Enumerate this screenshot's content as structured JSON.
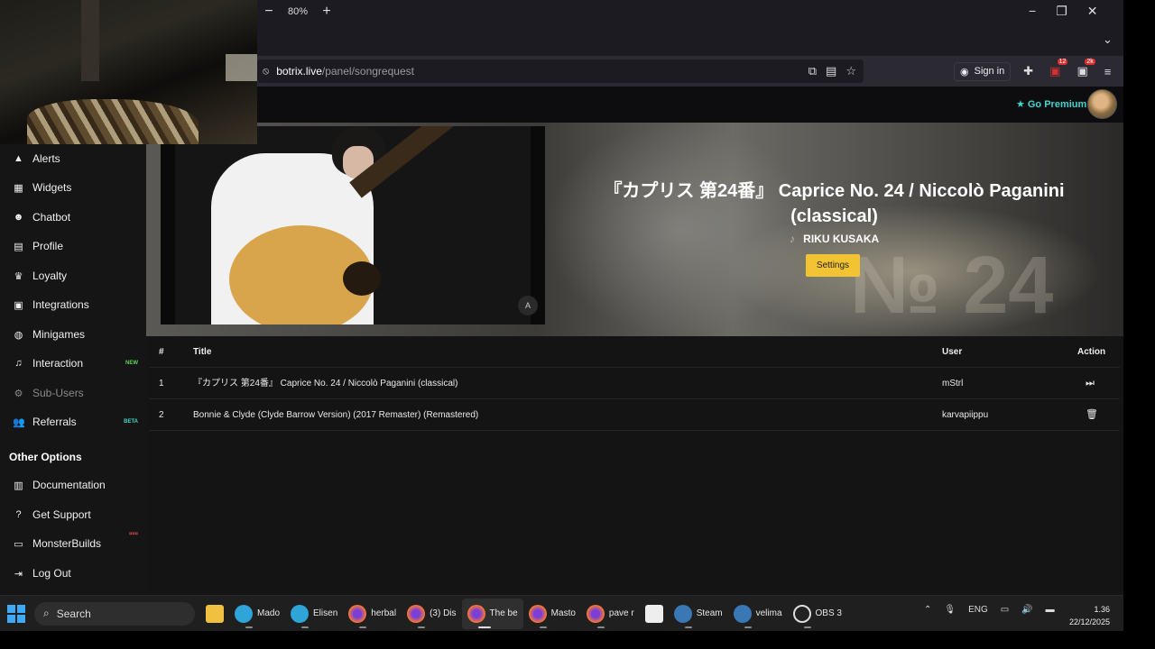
{
  "browser": {
    "zoom": "80%",
    "url_host": "botrix.live",
    "url_path": "/panel/songrequest",
    "sign_in": "Sign in",
    "ext_badge": "12",
    "ext_badge2": "2k"
  },
  "header": {
    "premium": "Go Premium"
  },
  "sidebar": {
    "items": [
      {
        "label": "Alerts",
        "icon": "warning-icon"
      },
      {
        "label": "Widgets",
        "icon": "grid-icon"
      },
      {
        "label": "Chatbot",
        "icon": "robot-icon"
      },
      {
        "label": "Profile",
        "icon": "id-card-icon"
      },
      {
        "label": "Loyalty",
        "icon": "trophy-icon"
      },
      {
        "label": "Integrations",
        "icon": "integration-icon"
      },
      {
        "label": "Minigames",
        "icon": "gamepad-icon"
      },
      {
        "label": "Interaction",
        "icon": "music-icon",
        "tag": "NEW"
      },
      {
        "label": "Sub-Users",
        "icon": "user-cog-icon"
      },
      {
        "label": "Referrals",
        "icon": "users-icon",
        "tag": "BETA"
      }
    ],
    "other_title": "Other Options",
    "other_items": [
      {
        "label": "Documentation",
        "icon": "scroll-icon"
      },
      {
        "label": "Get Support",
        "icon": "question-icon"
      },
      {
        "label": "MonsterBuilds",
        "icon": "laptop-icon",
        "tag": "¤¤¤"
      },
      {
        "label": "Log Out",
        "icon": "logout-icon"
      }
    ]
  },
  "now_playing": {
    "title": "『カプリス 第24番』 Caprice No. 24 / Niccolò Paganini (classical)",
    "artist": "RIKU KUSAKA",
    "settings_label": "Settings"
  },
  "queue": {
    "headers": {
      "num": "#",
      "title": "Title",
      "user": "User",
      "action": "Action"
    },
    "rows": [
      {
        "num": "1",
        "title": "『カプリス 第24番』 Caprice No. 24 / Niccolò Paganini (classical)",
        "user": "mStrl",
        "action": "skip-icon"
      },
      {
        "num": "2",
        "title": "Bonnie & Clyde (Clyde Barrow Version) (2017 Remaster) (Remastered)",
        "user": "karvapiippu",
        "action": "trash-icon"
      }
    ]
  },
  "taskbar": {
    "search": "Search",
    "apps": [
      "Mado",
      "Elisen",
      "herbal",
      "(3) Dis",
      "The be",
      "Masto",
      "pave r",
      "Steam",
      "velima",
      "OBS 3"
    ],
    "lang": "ENG",
    "time": "1.36",
    "date": "22/12/2025"
  },
  "colors": {
    "accent_premium": "#3fd6d0",
    "settings_button": "#f2c433",
    "tag_new": "#5fd35f",
    "tag_beta": "#3fd6d0"
  }
}
